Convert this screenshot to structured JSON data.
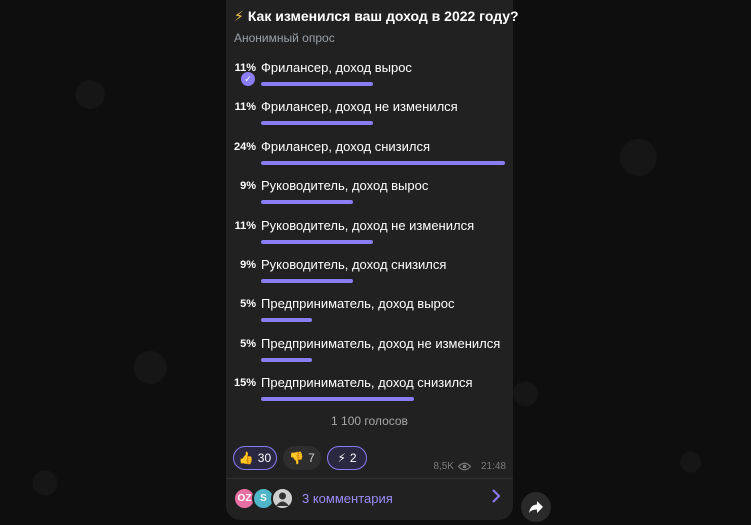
{
  "poll": {
    "title": "Как изменился ваш доход в 2022 году?",
    "title_icon": "⚡",
    "type": "Анонимный опрос",
    "total_votes": "1 100 голосов",
    "options": [
      {
        "percent": "11%",
        "percent_value": 11,
        "label": "Фрилансер, доход вырос",
        "voted": true
      },
      {
        "percent": "11%",
        "percent_value": 11,
        "label": "Фрилансер, доход не изменился",
        "voted": false
      },
      {
        "percent": "24%",
        "percent_value": 24,
        "label": "Фрилансер, доход снизился",
        "voted": false
      },
      {
        "percent": "9%",
        "percent_value": 9,
        "label": "Руководитель, доход вырос",
        "voted": false
      },
      {
        "percent": "11%",
        "percent_value": 11,
        "label": "Руководитель, доход не изменился",
        "voted": false
      },
      {
        "percent": "9%",
        "percent_value": 9,
        "label": "Руководитель, доход снизился",
        "voted": false
      },
      {
        "percent": "5%",
        "percent_value": 5,
        "label": "Предприниматель, доход вырос",
        "voted": false
      },
      {
        "percent": "5%",
        "percent_value": 5,
        "label": "Предприниматель, доход не изменился",
        "voted": false
      },
      {
        "percent": "15%",
        "percent_value": 15,
        "label": "Предприниматель, доход снизился",
        "voted": false
      }
    ]
  },
  "reactions": [
    {
      "emoji": "👍",
      "count": "30",
      "selected": true,
      "icon": "thumbs-up-icon"
    },
    {
      "emoji": "👎",
      "count": "7",
      "selected": false,
      "icon": "thumbs-down-icon"
    },
    {
      "emoji": "⚡",
      "count": "2",
      "selected": true,
      "icon": "lightning-icon"
    }
  ],
  "meta": {
    "views": "8,5K",
    "time": "21:48"
  },
  "comments": {
    "label": "3 комментария",
    "avatars": [
      {
        "text": "OZ",
        "color": "#e86fa2"
      },
      {
        "text": "S",
        "color": "#4fb6c9"
      },
      {
        "text": "",
        "color": "#cfcfcf"
      }
    ]
  },
  "colors": {
    "accent": "#8a7cf3",
    "bubble": "#212121",
    "background": "#0e0e0e"
  }
}
